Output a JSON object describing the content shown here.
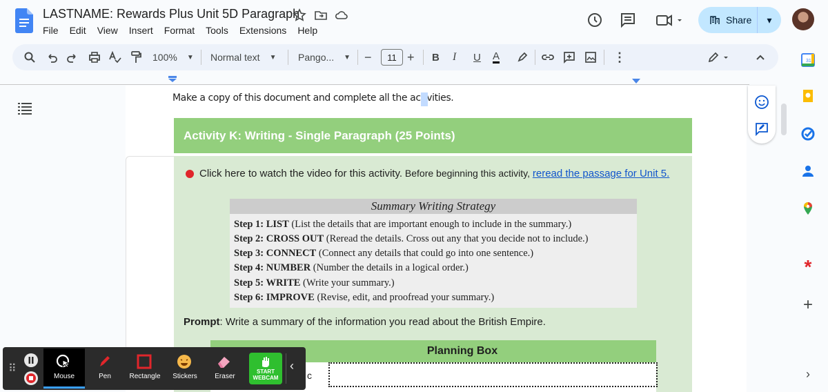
{
  "app": {
    "title": "LASTNAME: Rewards Plus Unit 5D Paragraph",
    "menus": [
      "File",
      "Edit",
      "View",
      "Insert",
      "Format",
      "Tools",
      "Extensions",
      "Help"
    ],
    "share_label": "Share"
  },
  "toolbar": {
    "zoom": "100%",
    "style": "Normal text",
    "font": "Pango...",
    "font_size": "11",
    "bold": "B",
    "italic": "I",
    "underline": "U",
    "text_color": "A"
  },
  "document": {
    "intro": "Make a copy of this document and complete all the activities.",
    "activity_title": "Activity K: Writing - Single Paragraph (25 Points)",
    "instruction_text": "Click here to watch the video for this activity.",
    "instruction_small": " Before beginning this activity, ",
    "instruction_link": "reread the passage for Unit 5.",
    "strategy": {
      "title": "Summary Writing Strategy",
      "steps": [
        {
          "label": "Step 1: LIST",
          "text": " (List the details that are important enough to include in the summary.)"
        },
        {
          "label": "Step 2: CROSS OUT",
          "text": " (Reread the details. Cross out any that you decide not to include.)"
        },
        {
          "label": "Step 3: CONNECT",
          "text": " (Connect any details that could go into one sentence.)"
        },
        {
          "label": "Step 4: NUMBER",
          "text": " (Number the details in a logical order.)"
        },
        {
          "label": "Step 5: WRITE",
          "text": " (Write your summary.)"
        },
        {
          "label": "Step 6: IMPROVE",
          "text": " (Revise, edit, and proofread your summary.)"
        }
      ]
    },
    "prompt_label": "Prompt",
    "prompt_text": ": Write a summary of the information you read about the British Empire.",
    "planning_box_title": "Planning Box",
    "planning_partial": "c"
  },
  "recorder": {
    "tools": [
      "Mouse",
      "Pen",
      "Rectangle",
      "Stickers",
      "Eraser"
    ],
    "webcam_line1": "START",
    "webcam_line2": "WEBCAM"
  },
  "colors": {
    "activity_header": "#93cf7d",
    "activity_body": "#d9ead3",
    "share_bg": "#c2e7ff",
    "link": "#1155cc"
  }
}
